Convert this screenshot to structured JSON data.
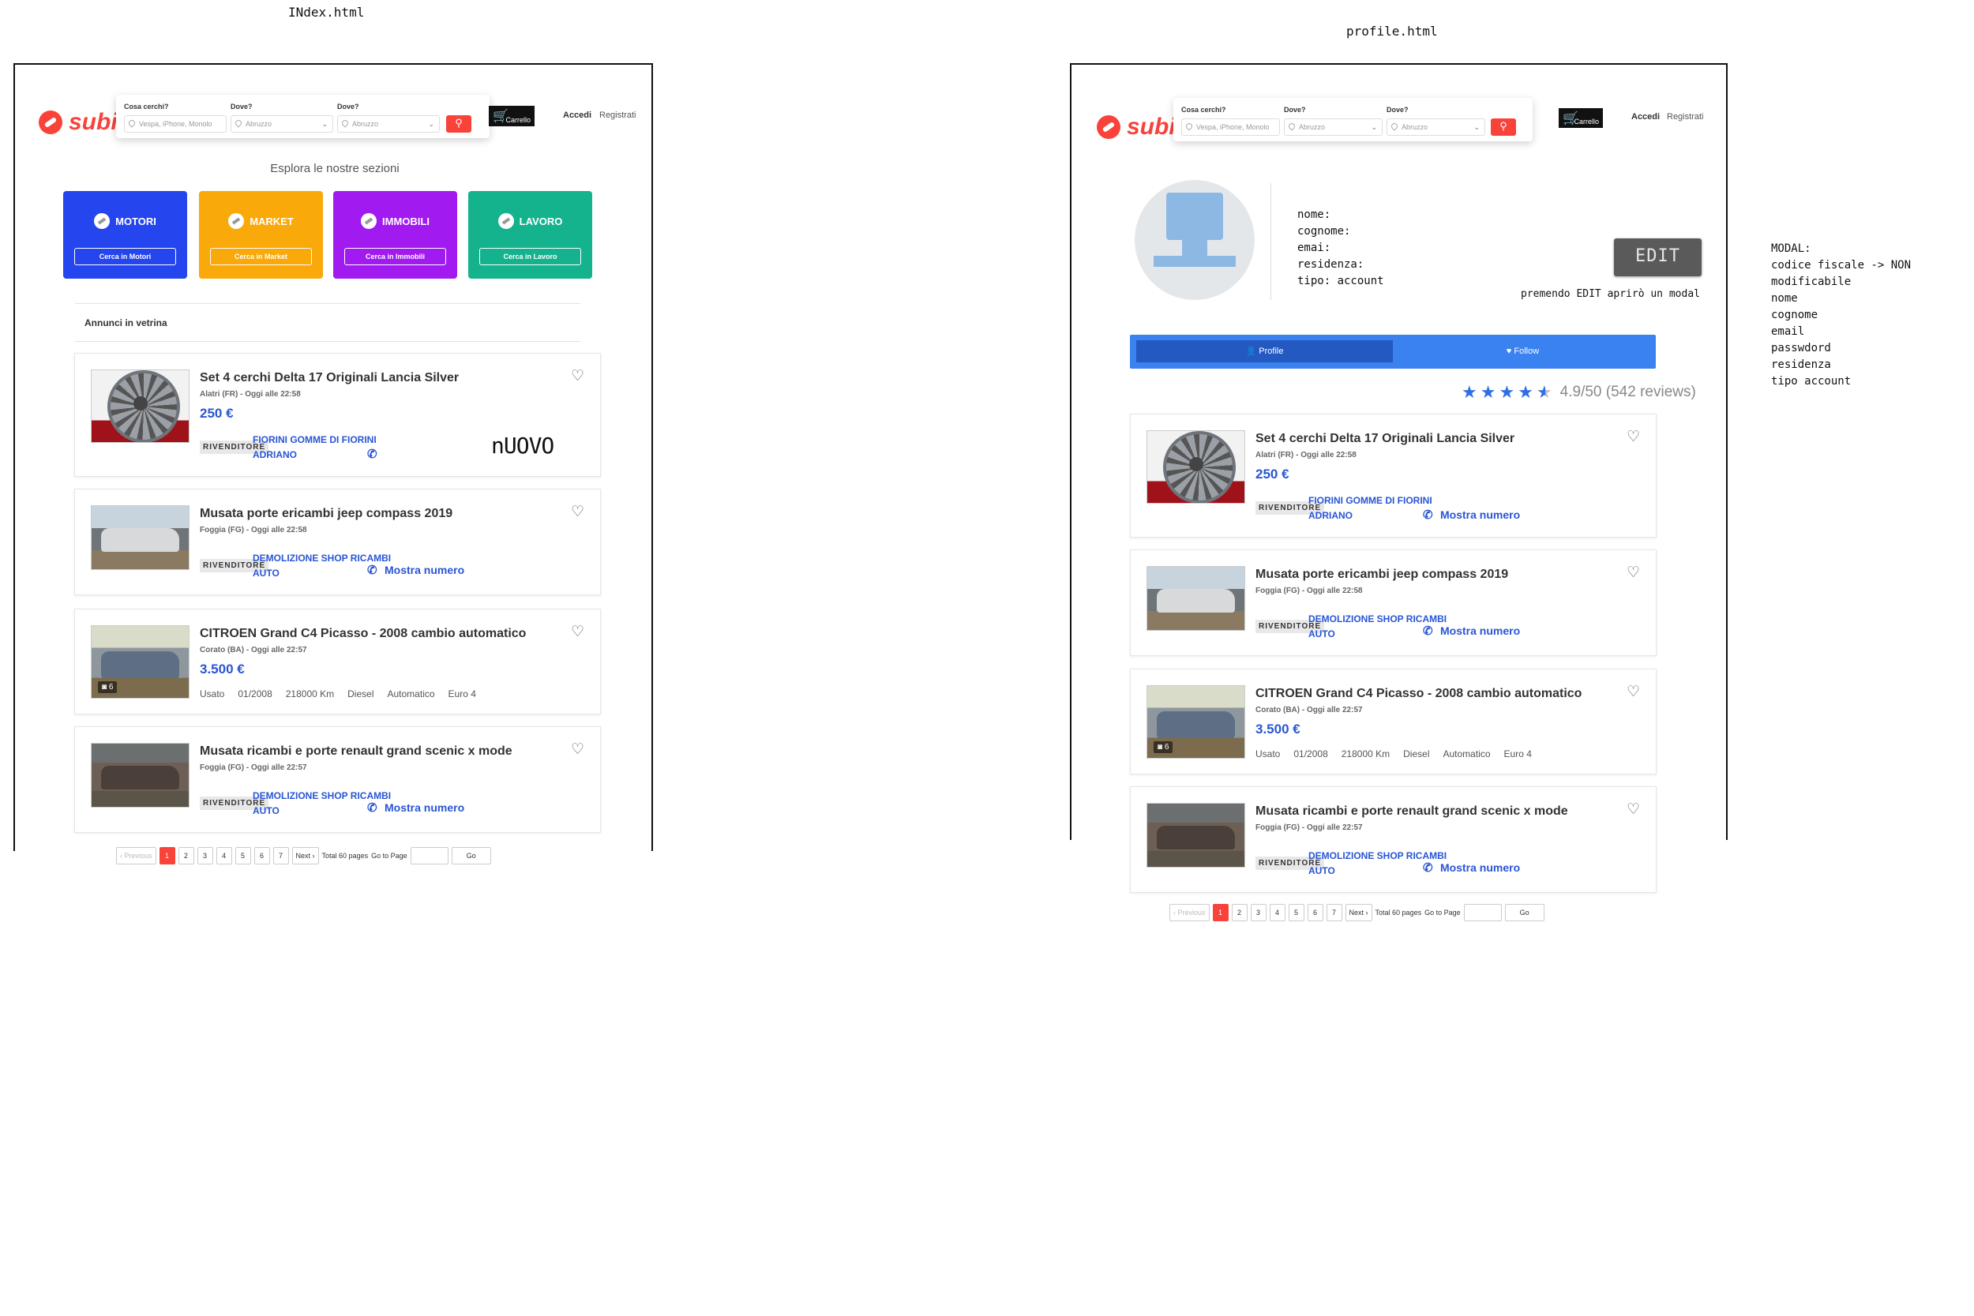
{
  "annotations": {
    "index_label": "INdex.html",
    "profile_label": "profile.html",
    "nuovo_text": "nUOVO",
    "edit_note": "premendo EDIT aprirò un modal",
    "modal_title": "MODAL:",
    "modal_items": [
      "codice fiscale -> NON modificabile",
      "nome",
      "cognome",
      "email",
      "passwdord",
      "residenza",
      "tipo account"
    ]
  },
  "header": {
    "logo": "subito",
    "search_what_label": "Cosa cerchi?",
    "search_what_placeholder": "Vespa, iPhone, Monolo",
    "search_where_label": "Dove?",
    "search_where_value": "Abruzzo",
    "search_where2_label": "Dove?",
    "search_where2_value": "Abruzzo",
    "cart_label": "Carrello",
    "login": "Accedi",
    "register": "Registrati"
  },
  "sections": {
    "title": "Esplora le nostre sezioni",
    "tiles": [
      {
        "name": "MOTORI",
        "button": "Cerca in Motori",
        "color": "#2545ee"
      },
      {
        "name": "MARKET",
        "button": "Cerca in Market",
        "color": "#f9a90a"
      },
      {
        "name": "IMMOBILI",
        "button": "Cerca in Immobili",
        "color": "#a11af0"
      },
      {
        "name": "LAVORO",
        "button": "Cerca in Lavoro",
        "color": "#14b28d"
      }
    ]
  },
  "vetrina_title": "Annunci in vetrina",
  "listings": [
    {
      "title": "Set 4 cerchi Delta 17 Originali Lancia Silver",
      "sub": "Alatri (FR) - Oggi alle 22:58",
      "price": "250 €",
      "badge": "RIVENDITORE",
      "seller": "FIORINI GOMME DI FIORINI ADRIANO",
      "phone": "Mostra numero"
    },
    {
      "title": "Musata porte ericambi jeep compass 2019",
      "sub": "Foggia (FG) - Oggi alle 22:58",
      "badge": "RIVENDITORE",
      "seller": "DEMOLIZIONE SHOP RICAMBI AUTO",
      "phone": "Mostra numero"
    },
    {
      "title": "CITROEN Grand C4 Picasso - 2008 cambio automatico",
      "sub": "Corato (BA) - Oggi alle 22:57",
      "price": "3.500 €",
      "specs": [
        "Usato",
        "01/2008",
        "218000 Km",
        "Diesel",
        "Automatico",
        "Euro 4"
      ],
      "photos": "6"
    },
    {
      "title": "Musata ricambi e porte renault grand scenic x mode",
      "sub": "Foggia (FG) - Oggi alle 22:57",
      "badge": "RIVENDITORE",
      "seller": "DEMOLIZIONE SHOP RICAMBI AUTO",
      "phone": "Mostra numero"
    }
  ],
  "pagination": {
    "prev": "‹ Previous",
    "pages": [
      "1",
      "2",
      "3",
      "4",
      "5",
      "6",
      "7"
    ],
    "current": "1",
    "next": "Next ›",
    "total": "Total 60 pages",
    "goto": "Go to Page",
    "go": "Go"
  },
  "profile": {
    "fields": [
      "nome:",
      "cognome:",
      "emai:",
      "residenza:",
      "tipo: account"
    ],
    "edit_button": "EDIT",
    "tab_profile": "Profile",
    "tab_follow": "Follow",
    "rating_stars": 4.5,
    "rating_text": "4.9/50 (542 reviews)"
  },
  "colors": {
    "brand_red": "#f9423a",
    "link_blue": "#2855d4",
    "tab_blue": "#3a82f0"
  }
}
